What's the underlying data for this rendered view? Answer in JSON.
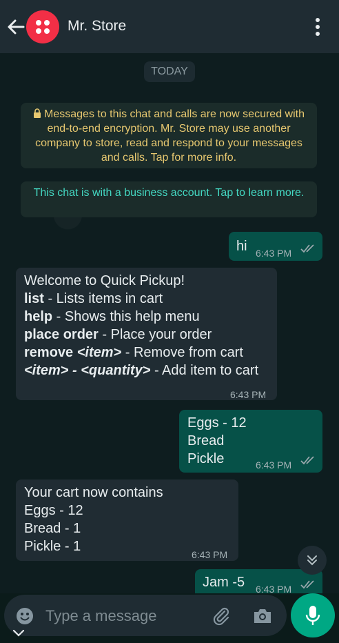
{
  "header": {
    "contact_name": "Mr. Store"
  },
  "chat": {
    "date_label": "TODAY",
    "encryption_notice": "Messages to this chat and calls are now secured with end-to-end encryption. Mr. Store may use another company to store, read and respond to your messages and calls. Tap for more info.",
    "business_notice": "This chat is with a business account. Tap to learn more.",
    "messages": [
      {
        "direction": "out",
        "lines": [
          "hi"
        ],
        "time": "6:43 PM"
      },
      {
        "direction": "in",
        "lines": [
          "Welcome to Quick Pickup!"
        ],
        "time": "6:43 PM",
        "commands": [
          {
            "cmd": "list",
            "desc": " - Lists items in cart"
          },
          {
            "cmd": "help",
            "desc": " - Shows this help menu"
          },
          {
            "cmd": "place order",
            "desc": " - Place your order"
          },
          {
            "cmd": "remove ",
            "arg": "<item>",
            "desc": " - Remove from cart"
          },
          {
            "cmd": "",
            "arg": "<item> - <quantity>",
            "desc": " - Add item to cart"
          }
        ]
      },
      {
        "direction": "out",
        "lines": [
          "Eggs - 12",
          "Bread",
          "Pickle"
        ],
        "time": "6:43 PM"
      },
      {
        "direction": "in",
        "lines": [
          "Your cart now contains",
          "Eggs - 12",
          "Bread - 1",
          "Pickle - 1"
        ],
        "time": "6:43 PM"
      },
      {
        "direction": "out",
        "lines": [
          "Jam -5"
        ],
        "time": "6:43 PM"
      }
    ]
  },
  "composer": {
    "placeholder": "Type a message"
  },
  "colors": {
    "header_bg": "#1f2c33",
    "outgoing_bubble": "#065148",
    "incoming_bubble": "#202c33",
    "accent": "#00a884",
    "encryption_text": "#e7c870",
    "business_text": "#44d8c2"
  }
}
